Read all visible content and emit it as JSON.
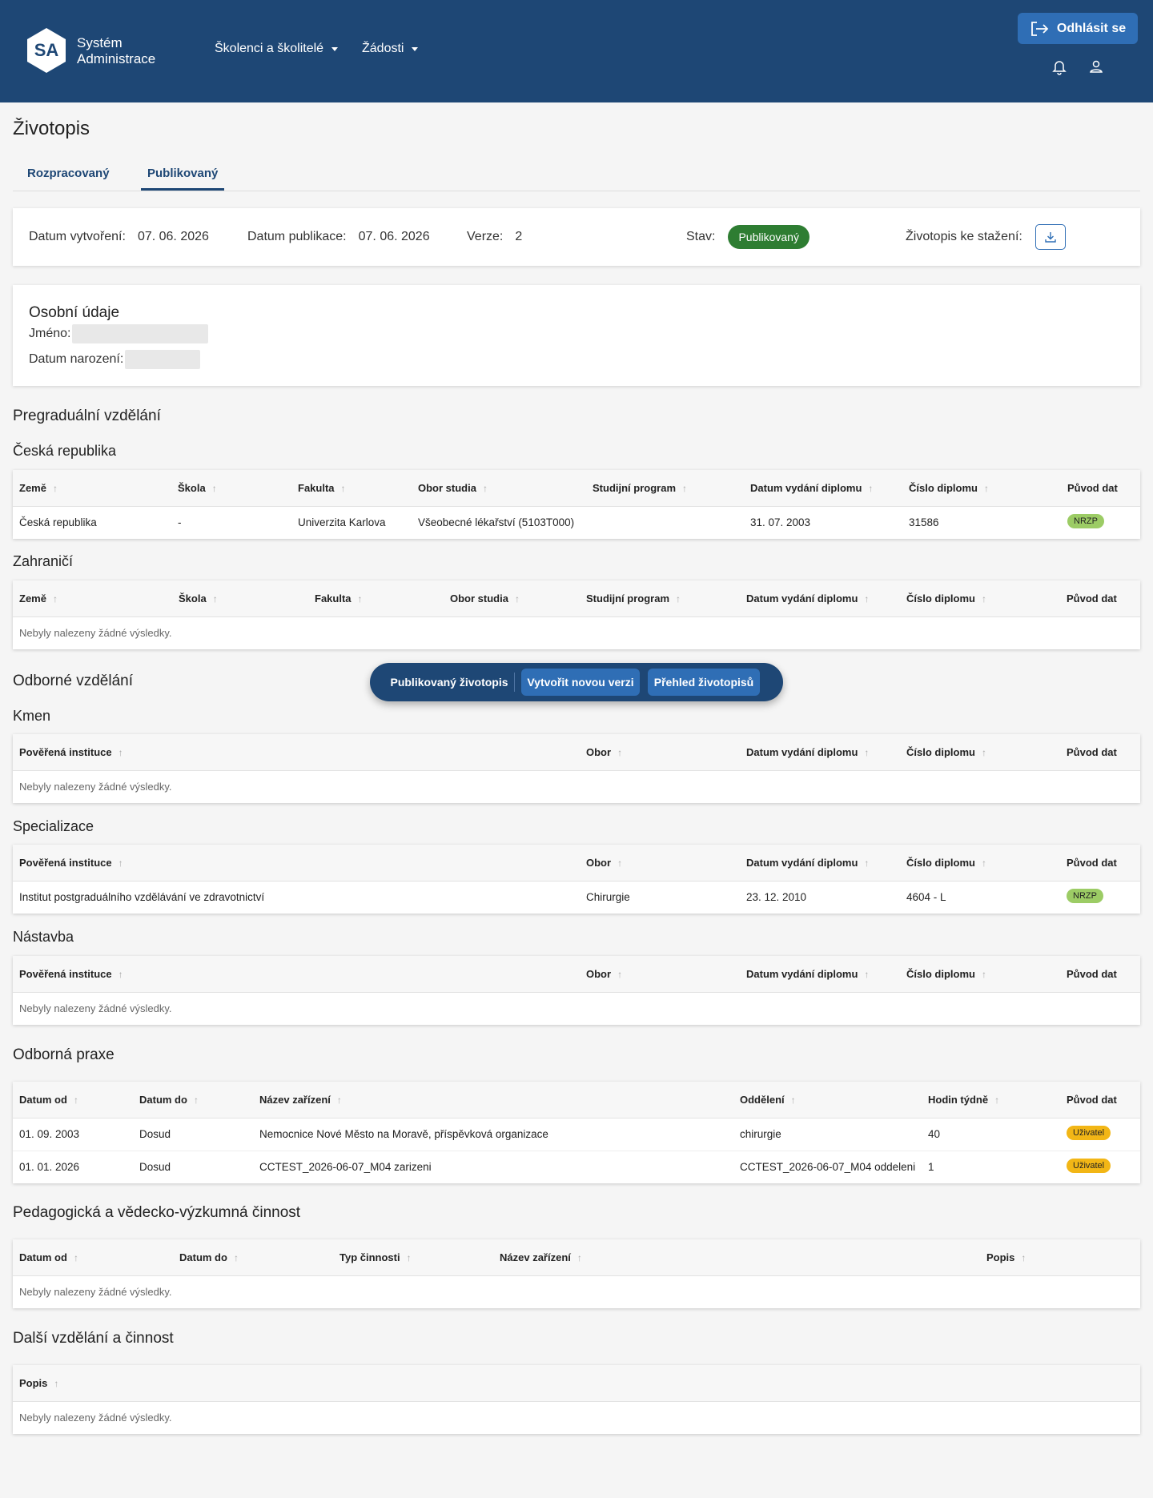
{
  "header": {
    "logo_abbr": "SA",
    "logo_line1": "Systém",
    "logo_line2": "Administrace",
    "nav": [
      "Školenci a školitelé",
      "Žádosti"
    ],
    "logout_label": "Odhlásit se"
  },
  "page": {
    "title": "Životopis",
    "tabs": [
      "Rozpracovaný",
      "Publikovaný"
    ],
    "active_tab": "Publikovaný"
  },
  "meta": {
    "created_label": "Datum vytvoření:",
    "created_value": "07. 06. 2026",
    "published_label": "Datum publikace:",
    "published_value": "07. 06. 2026",
    "version_label": "Verze:",
    "version_value": "2",
    "status_label": "Stav:",
    "status_value": "Publikovaný",
    "download_label": "Životopis ke stažení:"
  },
  "personal": {
    "title": "Osobní údaje",
    "name_label": "Jméno:",
    "birth_label": "Datum narození:"
  },
  "pregraduate": {
    "title": "Pregraduální vzdělání",
    "cz_title": "Česká republika",
    "abroad_title": "Zahraničí",
    "columns": [
      "Země",
      "Škola",
      "Fakulta",
      "Obor studia",
      "Studijní program",
      "Datum vydání diplomu",
      "Číslo diplomu",
      "Původ dat"
    ],
    "cz_rows": [
      [
        "Česká republika",
        "-",
        "Univerzita Karlova",
        "Všeobecné lékařství (5103T000)",
        "",
        "31. 07. 2003",
        "31586",
        "NRZP"
      ]
    ],
    "empty_text": "Nebyly nalezeny žádné výsledky."
  },
  "professional": {
    "title": "Odborné vzdělání",
    "columns": [
      "Pověřená instituce",
      "Obor",
      "Datum vydání diplomu",
      "Číslo diplomu",
      "Původ dat"
    ],
    "kmen_title": "Kmen",
    "spec_title": "Specializace",
    "spec_rows": [
      [
        "Institut postgraduálního vzdělávání ve zdravotnictví",
        "Chirurgie",
        "23. 12. 2010",
        "4604 - L",
        "NRZP"
      ]
    ],
    "nastavba_title": "Nástavba",
    "empty_text": "Nebyly nalezeny žádné výsledky."
  },
  "practice": {
    "title": "Odborná praxe",
    "columns": [
      "Datum od",
      "Datum do",
      "Název zařízení",
      "Oddělení",
      "Hodin týdně",
      "Původ dat"
    ],
    "rows": [
      [
        "01. 09. 2003",
        "Dosud",
        "Nemocnice Nové Město na Moravě, příspěvková organizace",
        "chirurgie",
        "40",
        "Uživatel"
      ],
      [
        "01. 01. 2026",
        "Dosud",
        "CCTEST_2026-06-07_M04 zarizeni",
        "CCTEST_2026-06-07_M04 oddeleni",
        "1",
        "Uživatel"
      ]
    ]
  },
  "pedagogic": {
    "title": "Pedagogická a vědecko-výzkumná činnost",
    "columns": [
      "Datum od",
      "Datum do",
      "Typ činnosti",
      "Název zařízení",
      "Popis"
    ],
    "empty_text": "Nebyly nalezeny žádné výsledky."
  },
  "other": {
    "title": "Další vzdělání a činnost",
    "columns": [
      "Popis"
    ],
    "empty_text": "Nebyly nalezeny žádné výsledky."
  },
  "floating_bar": {
    "label": "Publikovaný životopis",
    "new_version": "Vytvořit novou verzi",
    "overview": "Přehled životopisů"
  },
  "colors": {
    "header_bg": "#1e4775",
    "primary": "#2f6eb5",
    "status_green": "#2e7d32",
    "tag_nrzp": "#9ccc65",
    "tag_user": "#f2b616"
  }
}
